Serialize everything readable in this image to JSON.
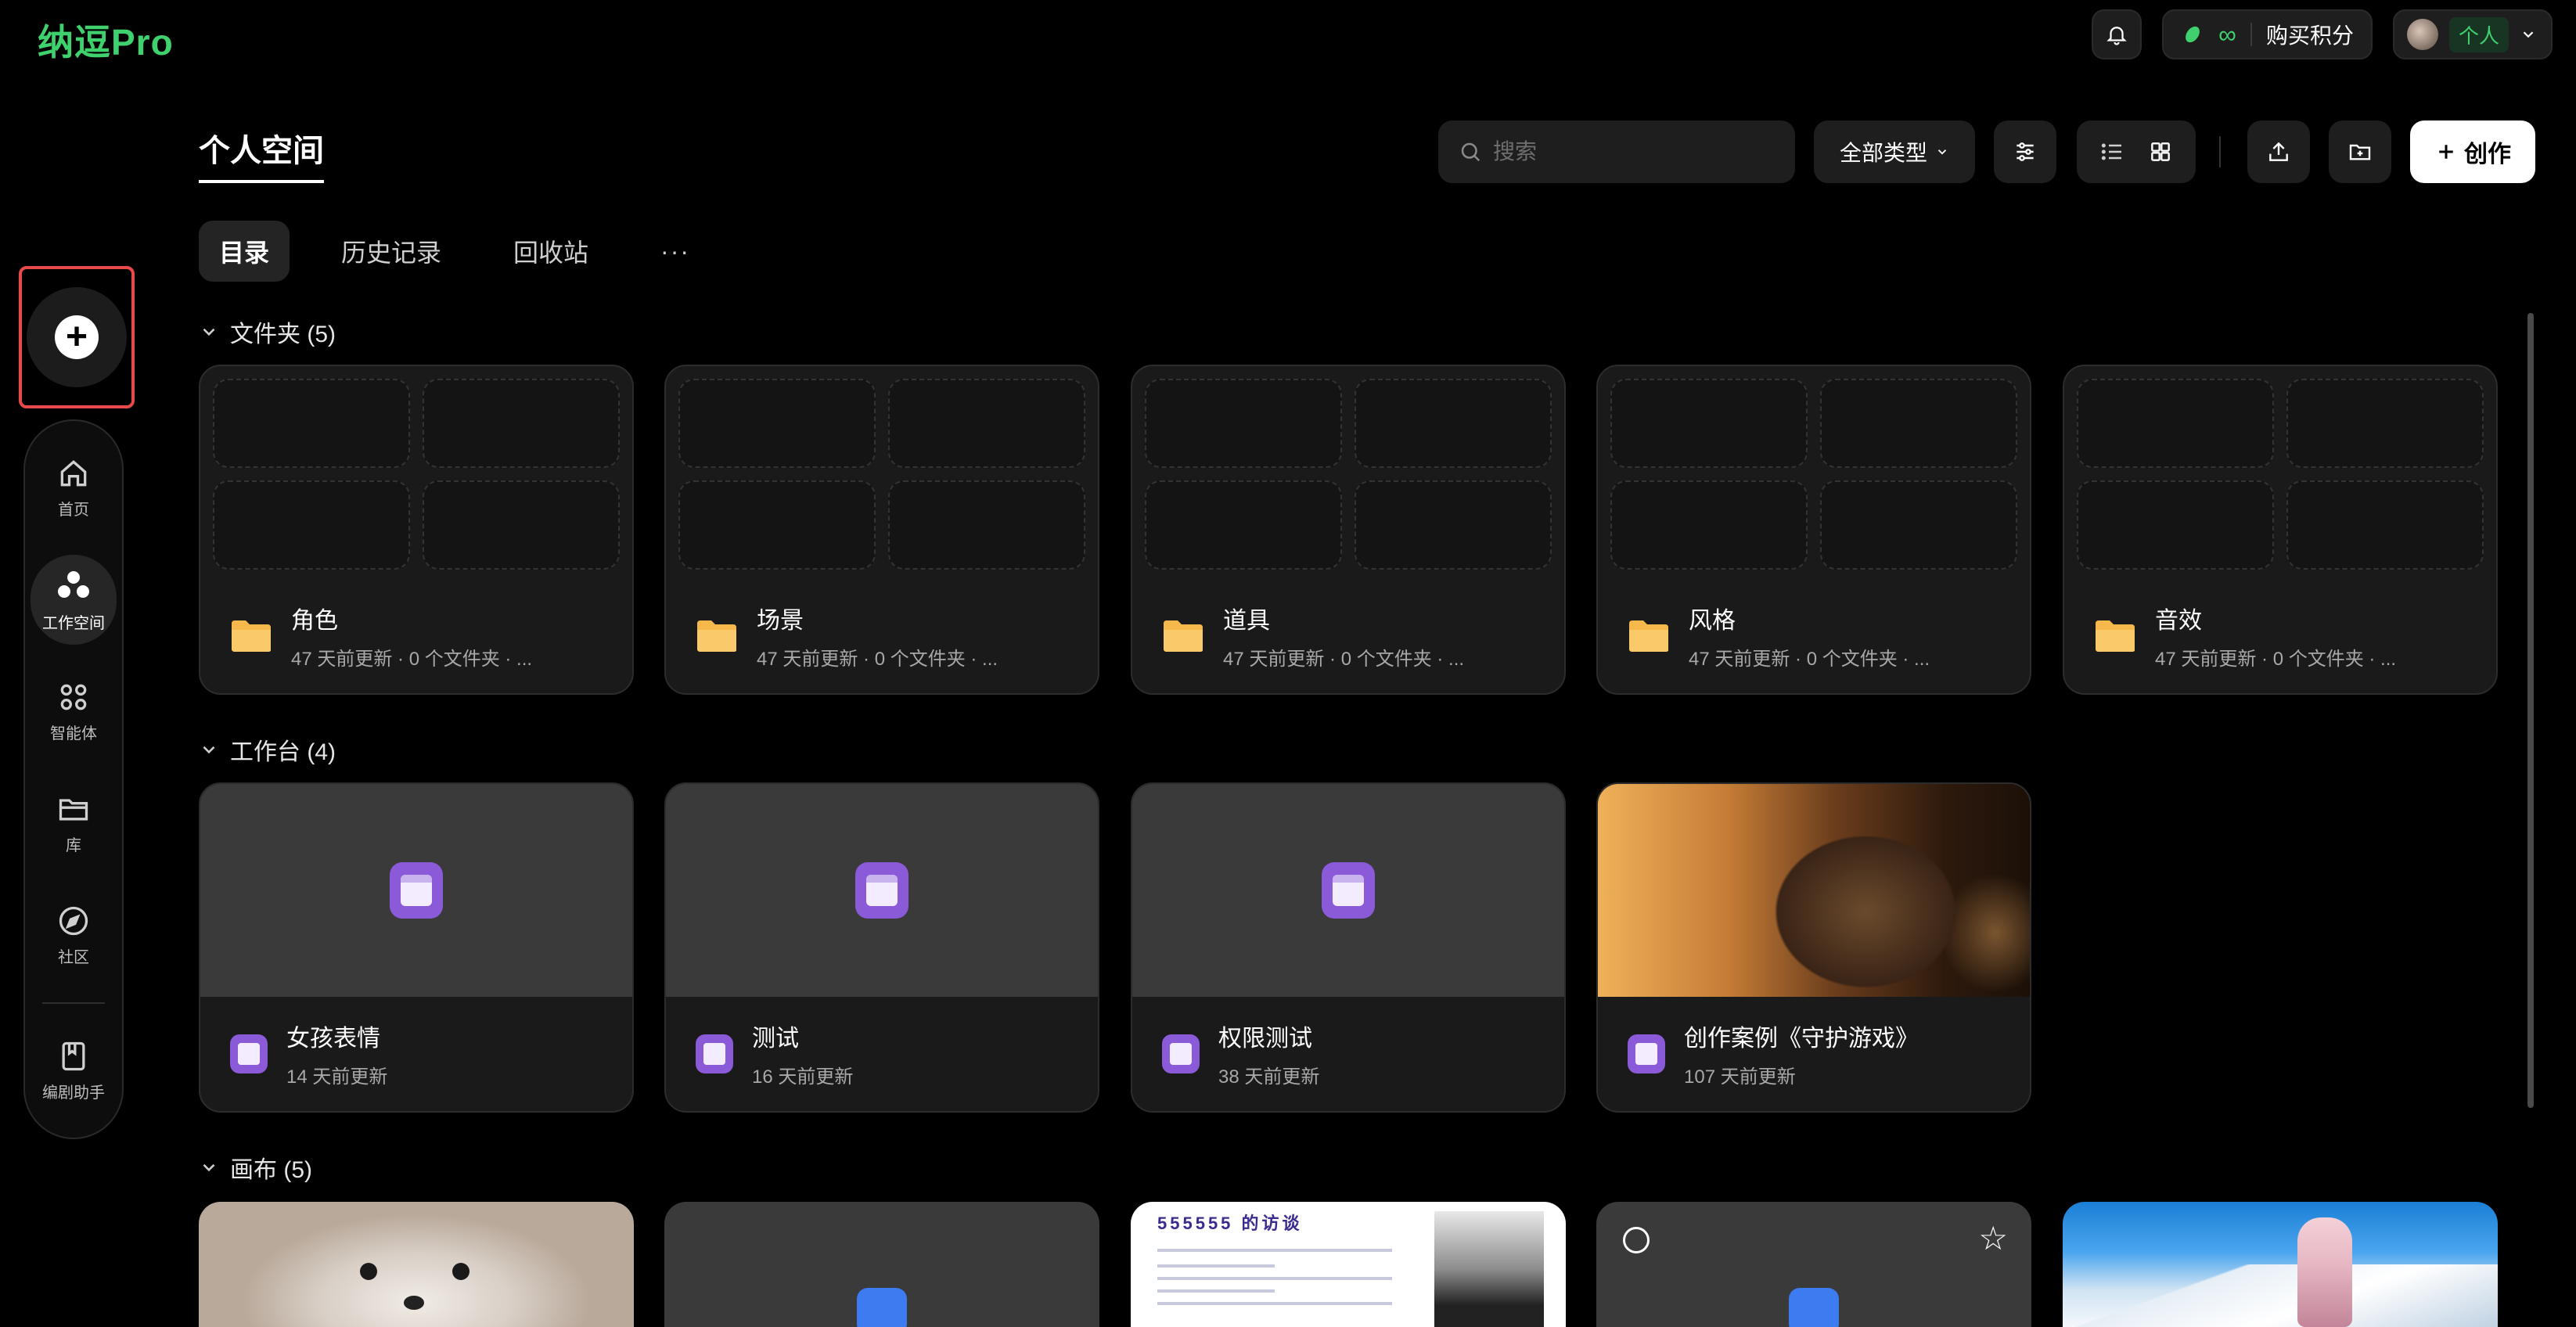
{
  "app": {
    "logo": "纳逗Pro"
  },
  "header": {
    "points_symbol": "∞",
    "buy_points_label": "购买积分",
    "user_mode_label": "个人"
  },
  "sidebar": {
    "items": [
      {
        "label": "首页",
        "icon": "home-icon"
      },
      {
        "label": "工作空间",
        "icon": "workspace-icon",
        "active": true
      },
      {
        "label": "智能体",
        "icon": "agents-grid-icon"
      },
      {
        "label": "库",
        "icon": "library-folder-icon"
      },
      {
        "label": "社区",
        "icon": "compass-icon"
      },
      {
        "label": "编剧助手",
        "icon": "script-assistant-icon"
      }
    ]
  },
  "main": {
    "title": "个人空间",
    "search_placeholder": "搜索",
    "type_filter": "全部类型",
    "create_label": "创作",
    "tabs": [
      {
        "label": "目录",
        "active": true
      },
      {
        "label": "历史记录"
      },
      {
        "label": "回收站"
      },
      {
        "label": "···"
      }
    ]
  },
  "sections": {
    "folders": {
      "title": "文件夹 (5)",
      "items": [
        {
          "name": "角色",
          "meta": "47 天前更新 · 0 个文件夹 · ..."
        },
        {
          "name": "场景",
          "meta": "47 天前更新 · 0 个文件夹 · ..."
        },
        {
          "name": "道具",
          "meta": "47 天前更新 · 0 个文件夹 · ..."
        },
        {
          "name": "风格",
          "meta": "47 天前更新 · 0 个文件夹 · ..."
        },
        {
          "name": "音效",
          "meta": "47 天前更新 · 0 个文件夹 · ..."
        }
      ]
    },
    "workbenches": {
      "title": "工作台 (4)",
      "items": [
        {
          "name": "女孩表情",
          "meta": "14 天前更新"
        },
        {
          "name": "测试",
          "meta": "16 天前更新"
        },
        {
          "name": "权限测试",
          "meta": "38 天前更新"
        },
        {
          "name": "创作案例《守护游戏》",
          "meta": "107 天前更新"
        }
      ]
    },
    "canvases": {
      "title": "画布 (5)",
      "doc_preview_title": "555555 的访谈"
    }
  },
  "colors": {
    "brand": "#3fd16e",
    "app_purple": "#8a5ad8",
    "folder_yellow": "#f6b84a",
    "highlight_red": "#e84a4a"
  }
}
